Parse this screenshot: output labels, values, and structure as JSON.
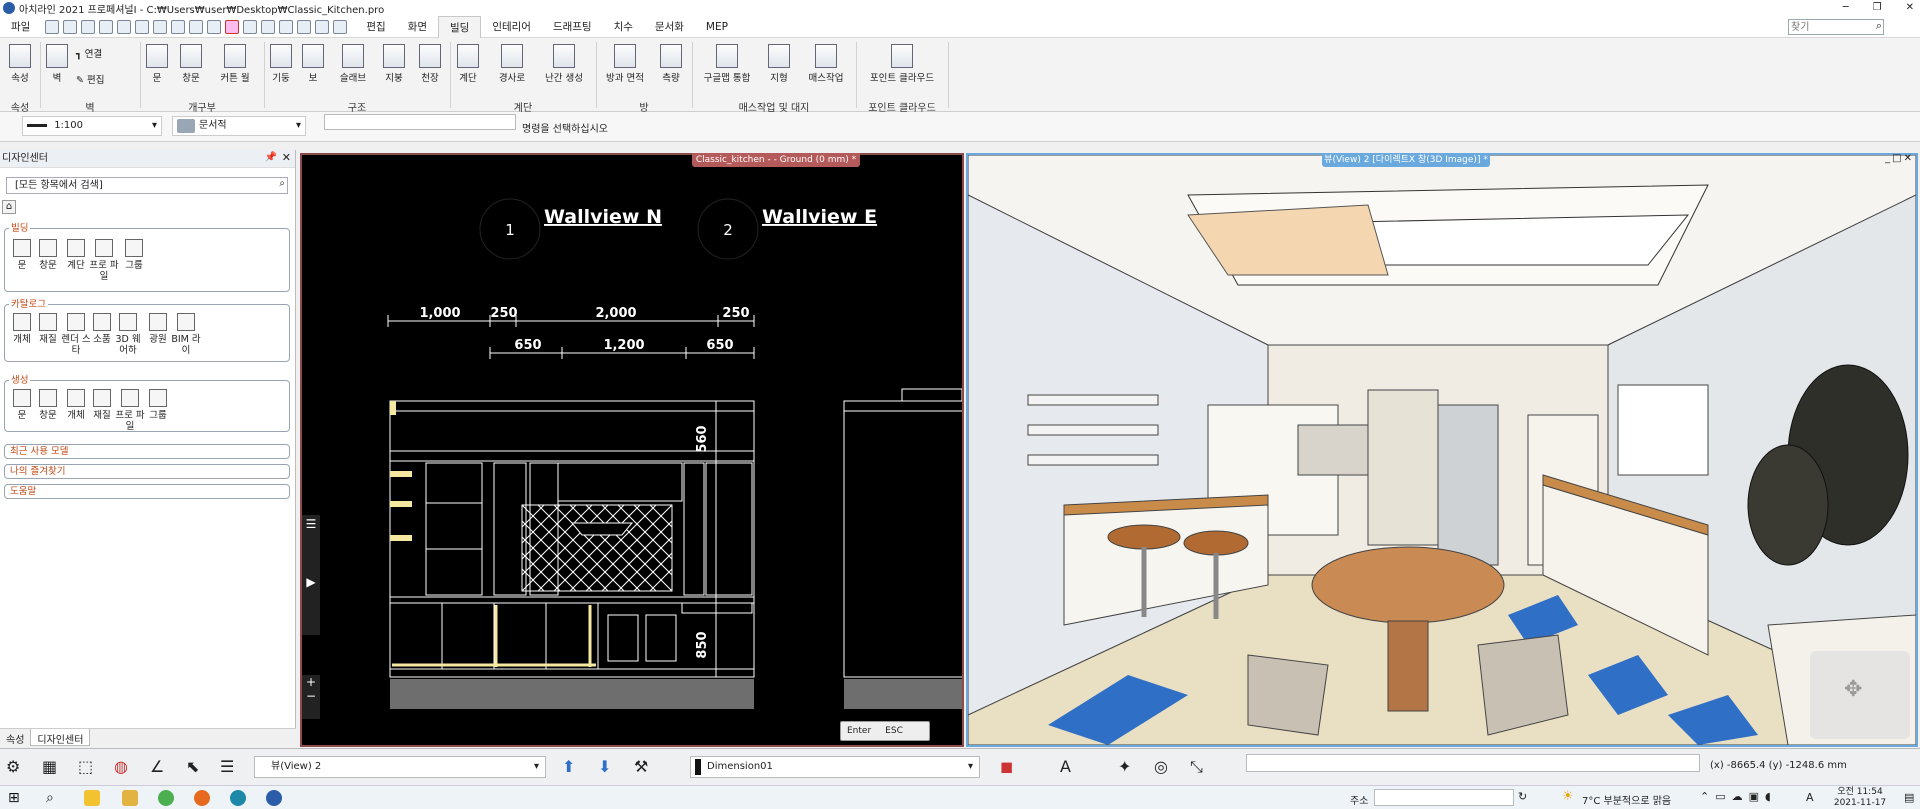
{
  "window": {
    "title": "아치라인 2021  프로페셔널I - C:₩Users₩user₩Desktop₩Classic_Kitchen.pro"
  },
  "menu": {
    "file": "파일",
    "tabs": [
      "편집",
      "화면",
      "빌딩",
      "인테리어",
      "드래프팅",
      "치수",
      "문서화",
      "MEP"
    ],
    "active_tab": "빌딩",
    "search_placeholder": "찾기"
  },
  "ribbon": {
    "buttons": [
      {
        "label": "속성",
        "icon": "properties-icon"
      },
      {
        "label": "벽",
        "icon": "wall-icon"
      },
      {
        "label": "연결",
        "icon": "connect-icon"
      },
      {
        "label": "편집",
        "icon": "edit-icon"
      },
      {
        "label": "문",
        "icon": "door-icon"
      },
      {
        "label": "창문",
        "icon": "window-icon"
      },
      {
        "label": "커튼 월",
        "icon": "curtain-wall-icon"
      },
      {
        "label": "기둥",
        "icon": "column-icon"
      },
      {
        "label": "보",
        "icon": "beam-icon"
      },
      {
        "label": "슬래브",
        "icon": "slab-icon"
      },
      {
        "label": "지붕",
        "icon": "roof-icon"
      },
      {
        "label": "천장",
        "icon": "ceiling-icon"
      },
      {
        "label": "계단",
        "icon": "stair-icon"
      },
      {
        "label": "경사로",
        "icon": "ramp-icon"
      },
      {
        "label": "난간 생성",
        "icon": "railing-icon"
      },
      {
        "label": "방과 면적",
        "icon": "room-area-icon"
      },
      {
        "label": "측량",
        "icon": "survey-icon"
      },
      {
        "label": "구글맵 통합",
        "icon": "google-map-icon"
      },
      {
        "label": "지형",
        "icon": "terrain-icon"
      },
      {
        "label": "매스작업",
        "icon": "mass-icon"
      },
      {
        "label": "포인트 클라우드",
        "icon": "point-cloud-icon"
      }
    ],
    "groups": [
      "속성",
      "벽",
      "개구부",
      "구조",
      "계단",
      "방",
      "매스작업 및 대지",
      "포인트 클라우드"
    ]
  },
  "optionbar": {
    "scale": "1:100",
    "layer": "문서적",
    "prompt": "명령을 선택하십시오"
  },
  "design_center": {
    "title": "디자인센터",
    "search": "[모든 항목에서 검색]",
    "sections": [
      {
        "title": "빌딩",
        "items": [
          "문",
          "창문",
          "계단",
          "프로 파일",
          "그룹"
        ]
      },
      {
        "title": "카탈로그",
        "items": [
          "개체",
          "재질",
          "렌더 스타",
          "소품",
          "3D 웨어하",
          "광원",
          "BIM 라이"
        ]
      },
      {
        "title": "생성",
        "items": [
          "문",
          "창문",
          "개체",
          "재질",
          "프로 파일",
          "그룹"
        ]
      }
    ],
    "collapsed": [
      "최근 사용 모델",
      "나의 즐겨찾기",
      "도움말"
    ],
    "bottom_tabs": [
      "속성",
      "디자인센터"
    ]
  },
  "view2d": {
    "title": "Classic_kitchen -  - Ground (0 mm) *",
    "marker1": "1",
    "label1": "Wallview N",
    "marker2": "2",
    "label2": "Wallview E",
    "dims_top": [
      "1,000",
      "250",
      "2,000",
      "250"
    ],
    "dims_bottom": [
      "650",
      "1,200",
      "650"
    ],
    "dim_v1": "560",
    "dim_v2": "850",
    "enter": "Enter",
    "esc": "ESC"
  },
  "view3d": {
    "title": "뷰(View) 2 [다이렉트X 창(3D Image)] *"
  },
  "statusbar": {
    "view": "뷰(View) 2",
    "dimension": "Dimension01",
    "coords": "(x) -8665.4    (y) -1248.6 mm"
  },
  "taskbar": {
    "address_label": "주소",
    "weather": "7°C  부분적으로 맑음",
    "ime": "A",
    "time": "오전 11:54",
    "date": "2021-11-17"
  }
}
